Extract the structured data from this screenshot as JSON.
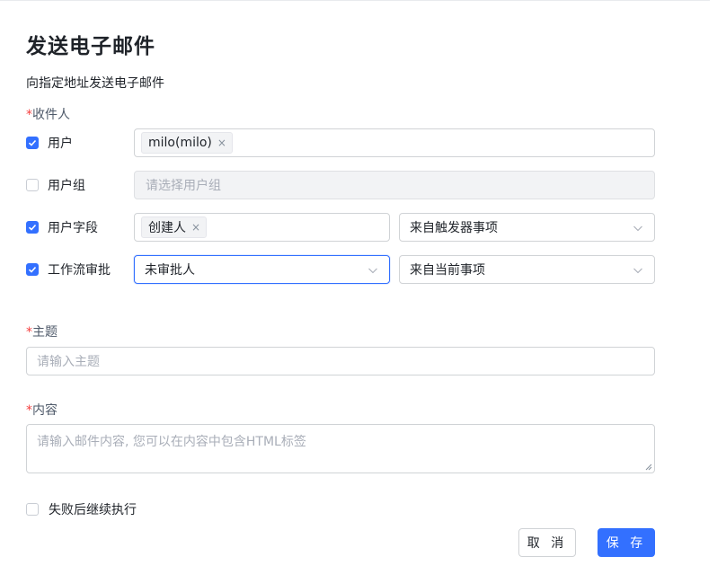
{
  "form": {
    "title": "发送电子邮件",
    "description": "向指定地址发送电子邮件",
    "recipients_label": "收件人",
    "required_mark": "*",
    "rows": {
      "user": {
        "label": "用户",
        "checked": true,
        "tag": "milo(milo)"
      },
      "user_group": {
        "label": "用户组",
        "checked": false,
        "placeholder": "请选择用户组"
      },
      "user_field": {
        "label": "用户字段",
        "checked": true,
        "tag": "创建人",
        "source": "来自触发器事项"
      },
      "workflow_approval": {
        "label": "工作流审批",
        "checked": true,
        "approver": "未审批人",
        "source": "来自当前事项"
      }
    },
    "subject_label": "主题",
    "subject_placeholder": "请输入主题",
    "content_label": "内容",
    "content_placeholder": "请输入邮件内容, 您可以在内容中包含HTML标签",
    "continue_on_fail": "失败后继续执行",
    "cancel_label": "取 消",
    "save_label": "保 存",
    "tag_remove": "×"
  },
  "colors": {
    "accent": "#3370ff",
    "required": "#f53f3f"
  }
}
